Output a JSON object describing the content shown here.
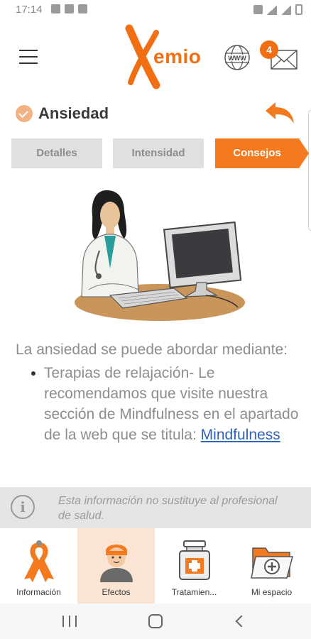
{
  "status_bar": {
    "time": "17:14"
  },
  "app_bar": {
    "logo_text": "emio",
    "badge_count": "4",
    "icons": [
      "menu-icon",
      "web-icon",
      "mail-icon"
    ]
  },
  "section": {
    "title": "Ansiedad",
    "check_icon": "check-icon",
    "back_icon": "back-arrow-icon"
  },
  "tabs": [
    {
      "label": "Detalles",
      "active": false
    },
    {
      "label": "Intensidad",
      "active": false
    },
    {
      "label": "Consejos",
      "active": true
    }
  ],
  "content": {
    "intro": "La ansiedad se puede abordar mediante:",
    "bullet_text": "Terapias de relajación- Le recomendamos que visite nuestra sección de Mindfulness en el apartado de  la web que se titula: ",
    "bullet_link": "Mindfulness"
  },
  "disclaimer": {
    "icon": "info-icon",
    "text": "Esta información no sustituye al profesional de salud."
  },
  "bottom_nav": [
    {
      "label": "Información",
      "icon": "ribbon-icon",
      "active": false
    },
    {
      "label": "Efectos",
      "icon": "patient-icon",
      "active": true
    },
    {
      "label": "Tratamien...",
      "icon": "medicine-icon",
      "active": false
    },
    {
      "label": "Mi espacio",
      "icon": "folder-add-icon",
      "active": false
    }
  ],
  "colors": {
    "accent": "#f47a20",
    "tab_inactive": "#e0e0e0",
    "link": "#2f63b9"
  }
}
